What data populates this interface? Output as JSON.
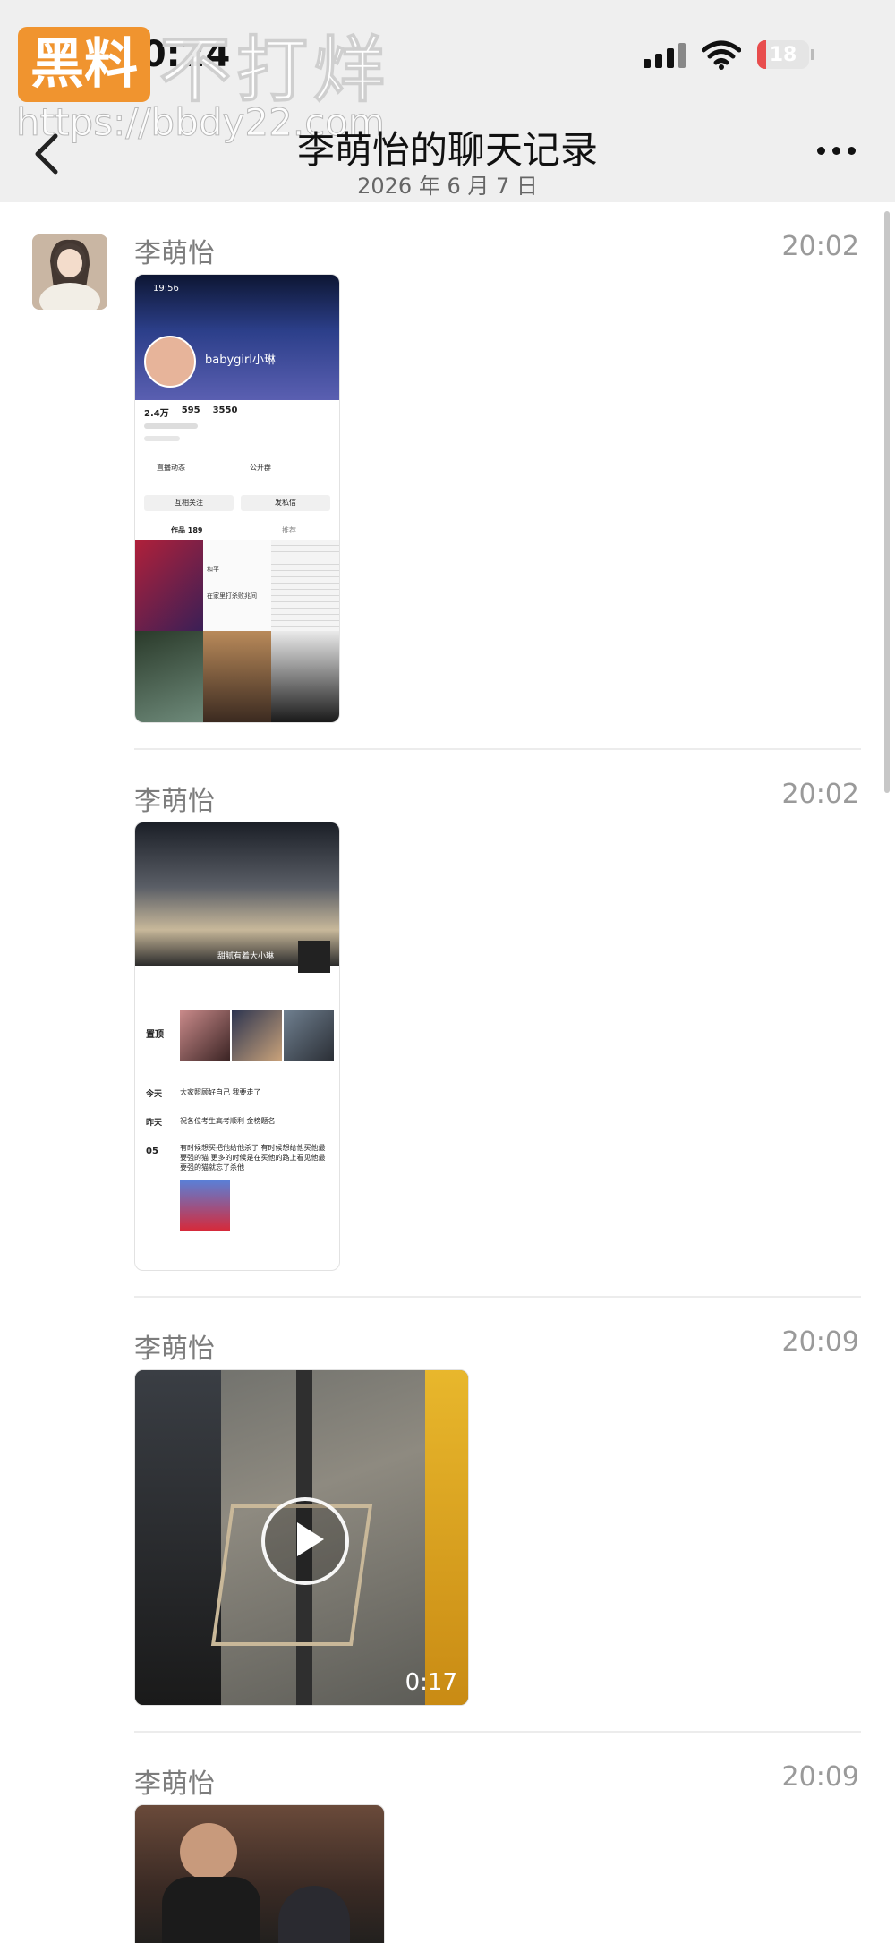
{
  "status_bar": {
    "time": "00:24",
    "battery": "18"
  },
  "watermark": {
    "badge": "黑料",
    "text": "不打烊",
    "url": "https://bbdy22.com"
  },
  "nav": {
    "title": "李萌怡的聊天记录",
    "subtitle": "2026 年 6 月 7 日"
  },
  "messages": [
    {
      "name": "李萌怡",
      "time": "20:02"
    },
    {
      "name": "李萌怡",
      "time": "20:02"
    },
    {
      "name": "李萌怡",
      "time": "20:09"
    },
    {
      "name": "李萌怡",
      "time": "20:09"
    }
  ],
  "screenshot1": {
    "time": "19:56",
    "username": "babygirl小琳",
    "stats": [
      "2.4万",
      "595",
      "3550"
    ],
    "row1": "直播动态",
    "row2": "公开群",
    "follow_button": "互相关注",
    "message_button": "发私信",
    "works_tab": "作品 189",
    "recommend_tab": "推荐",
    "grid_text": [
      "在家里打杀败兆间",
      "和平"
    ]
  },
  "screenshot2": {
    "banner_name": "甜腻有着大小琳",
    "pinned_label": "置顶",
    "rows": [
      {
        "day": "今天",
        "text": "大家照顾好自己 我要走了"
      },
      {
        "day": "昨天",
        "text": "祝各位考生高考顺利 金榜题名"
      },
      {
        "day": "05",
        "text": "有时候想买把他给他杀了 有时候想给他买他最要强的猫 更多的时候是在买他的路上看见他最要强的猫就忘了杀他"
      }
    ]
  },
  "video": {
    "duration": "0:17"
  },
  "colors": {
    "accent_orange": "#f0942f",
    "battery_red": "#e84c4c",
    "bar_gray": "#efefef"
  }
}
